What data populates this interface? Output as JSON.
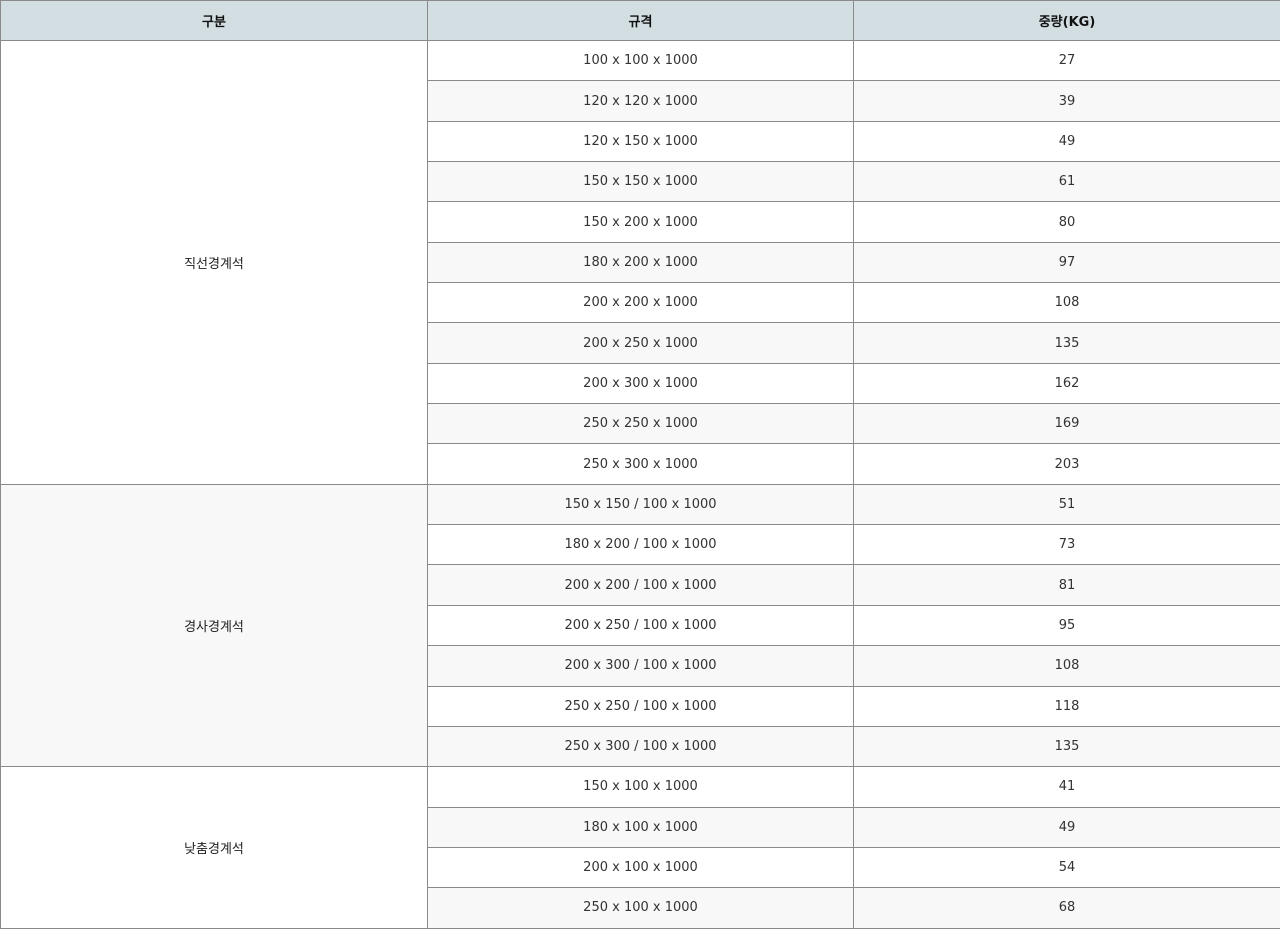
{
  "table": {
    "headers": {
      "category": "구분",
      "spec": "규격",
      "weight": "중량(KG)"
    },
    "groups": [
      {
        "name": "직선경계석",
        "rows": [
          {
            "spec": "100 x 100 x 1000",
            "weight": "27"
          },
          {
            "spec": "120 x 120 x 1000",
            "weight": "39"
          },
          {
            "spec": "120 x 150 x 1000",
            "weight": "49"
          },
          {
            "spec": "150 x 150 x 1000",
            "weight": "61"
          },
          {
            "spec": "150 x 200 x 1000",
            "weight": "80"
          },
          {
            "spec": "180 x 200 x 1000",
            "weight": "97"
          },
          {
            "spec": "200 x 200 x 1000",
            "weight": "108"
          },
          {
            "spec": "200 x 250 x 1000",
            "weight": "135"
          },
          {
            "spec": "200 x 300 x 1000",
            "weight": "162"
          },
          {
            "spec": "250 x 250 x 1000",
            "weight": "169"
          },
          {
            "spec": "250 x 300 x 1000",
            "weight": "203"
          }
        ]
      },
      {
        "name": "경사경계석",
        "rows": [
          {
            "spec": "150 x 150 / 100 x 1000",
            "weight": "51"
          },
          {
            "spec": "180 x 200 / 100 x 1000",
            "weight": "73"
          },
          {
            "spec": "200 x 200 / 100 x 1000",
            "weight": "81"
          },
          {
            "spec": "200 x 250 / 100 x 1000",
            "weight": "95"
          },
          {
            "spec": "200 x 300 / 100 x 1000",
            "weight": "108"
          },
          {
            "spec": "250 x 250 / 100 x 1000",
            "weight": "118"
          },
          {
            "spec": "250 x 300 / 100 x 1000",
            "weight": "135"
          }
        ]
      },
      {
        "name": "낮춤경계석",
        "rows": [
          {
            "spec": "150 x 100 x 1000",
            "weight": "41"
          },
          {
            "spec": "180 x 100 x 1000",
            "weight": "49"
          },
          {
            "spec": "200 x 100 x 1000",
            "weight": "54"
          },
          {
            "spec": "250 x 100 x 1000",
            "weight": "68"
          }
        ]
      }
    ]
  },
  "colors": {
    "header_bg": "#d3dee3",
    "alt_row_bg": "#f8f8f8",
    "border": "#8a8a8a"
  }
}
